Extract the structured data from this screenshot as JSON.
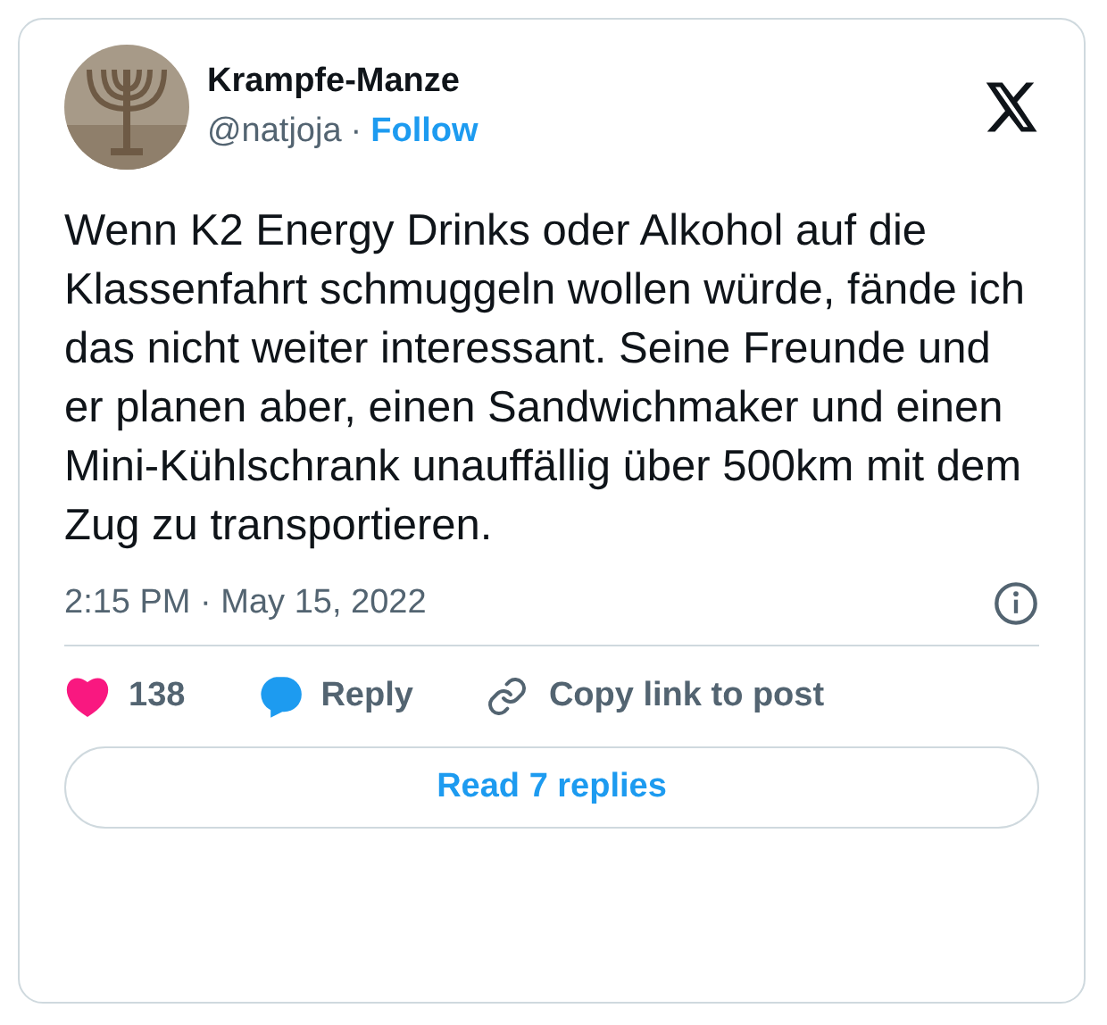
{
  "author": {
    "name": "Krampfe-Manze",
    "handle": "@natjoja",
    "separator": "·",
    "follow": "Follow"
  },
  "text": "Wenn K2 Energy Drinks oder Alkohol auf die Klassenfahrt schmuggeln wollen würde, fände ich das nicht weiter interessant. Seine Freunde und er planen aber, einen Sandwichmaker und einen Mini-Kühlschrank unauffällig über 500km mit dem Zug zu transportieren.",
  "timestamp": "2:15 PM · May 15, 2022",
  "actions": [
    {
      "kind": "like",
      "label": "138"
    },
    {
      "kind": "reply",
      "label": "Reply"
    },
    {
      "kind": "copy",
      "label": "Copy link to post"
    }
  ],
  "read_button": "Read 7 replies"
}
